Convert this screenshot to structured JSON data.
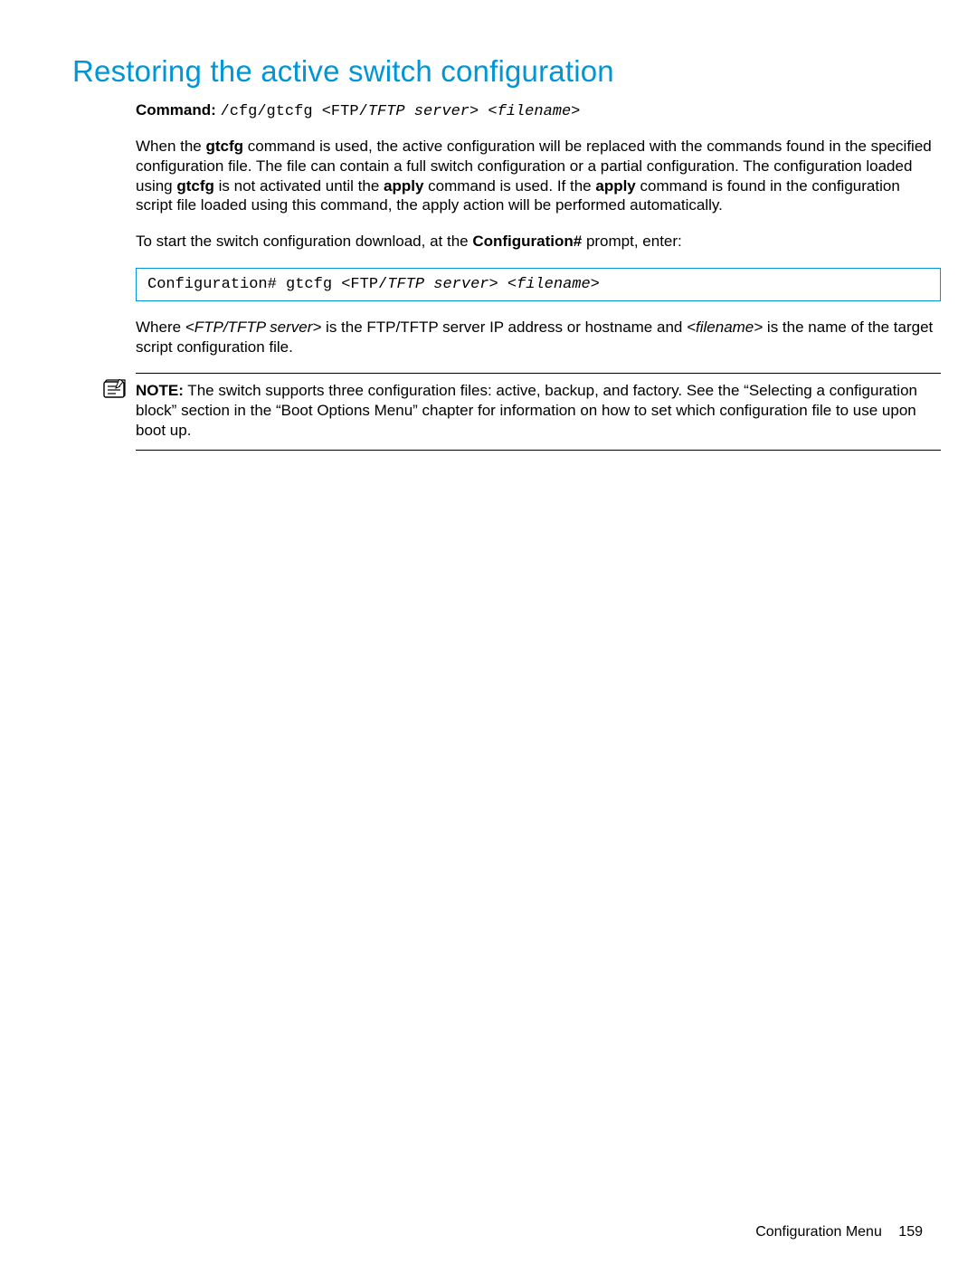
{
  "heading": "Restoring the active switch configuration",
  "command": {
    "label": "Command:",
    "cmd_prefix": "/cfg/gtcfg <FTP/",
    "cmd_italic": "TFTP server> <filename>"
  },
  "para1": {
    "seg1": "When the ",
    "b1": "gtcfg",
    "seg2": " command is used, the active configuration will be replaced with the commands found in the specified configuration file. The file can contain a full switch configuration or a partial configuration. The configuration loaded using ",
    "b2": "gtcfg",
    "seg3": " is not activated until the ",
    "b3": "apply",
    "seg4": " command is used. If the ",
    "b4": "apply",
    "seg5": " command is found in the configuration script file loaded using this command, the apply action will be performed automatically."
  },
  "para2": {
    "seg1": "To start the switch configuration download, at the ",
    "b1": "Configuration#",
    "seg2": " prompt, enter:"
  },
  "codebox": {
    "prompt": "Configuration#  gtcfg <FTP/",
    "italic": "TFTP server> <filename>",
    "close": ""
  },
  "para3": {
    "seg1": "Where ",
    "i1": "<FTP/TFTP server>",
    "seg2": " is the FTP/TFTP server IP address or hostname and ",
    "i2": "<filename>",
    "seg3": " is the name of the target script configuration file."
  },
  "note": {
    "label": "NOTE:",
    "text": "  The switch supports three configuration files: active, backup, and factory. See the “Selecting a configuration block” section in the “Boot Options Menu” chapter for information on how to set which configuration file to use upon boot up."
  },
  "footer": {
    "section": "Configuration Menu",
    "page": "159"
  },
  "icons": {
    "note": "note-icon"
  }
}
